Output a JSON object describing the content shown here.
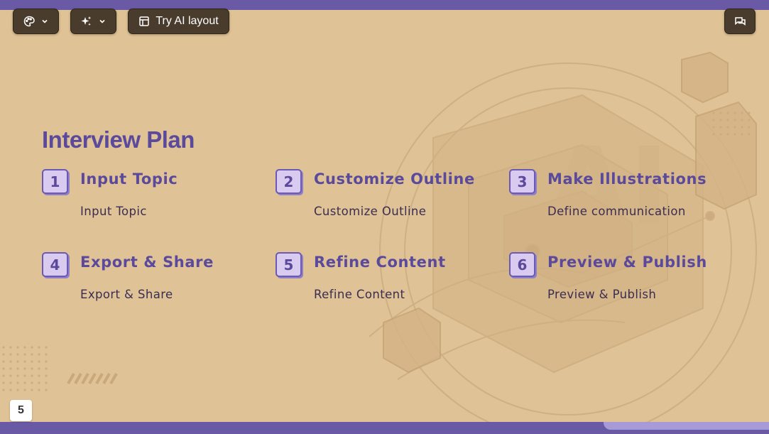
{
  "toolbar": {
    "theme_icon": "palette-icon",
    "ai_icon": "sparkles-icon",
    "layout_label": "Try AI layout",
    "layout_icon": "layout-icon",
    "comment_icon": "comment-icon"
  },
  "slide": {
    "title": "Interview Plan",
    "steps": [
      {
        "num": "1",
        "title": "Input Topic",
        "desc": "Input Topic"
      },
      {
        "num": "2",
        "title": "Customize Outline",
        "desc": "Customize Outline"
      },
      {
        "num": "3",
        "title": "Make Illustrations",
        "desc": "Define communication"
      },
      {
        "num": "4",
        "title": "Export & Share",
        "desc": "Export & Share"
      },
      {
        "num": "5",
        "title": "Refine Content",
        "desc": "Refine Content"
      },
      {
        "num": "6",
        "title": "Preview & Publish",
        "desc": "Preview & Publish"
      }
    ]
  },
  "page_number": "5",
  "colors": {
    "frame": "#6a5aa6",
    "slide_bg": "#dfc295",
    "accent_text": "#5b4a9c",
    "body_text": "#3b2d52",
    "toolbar_button": "#4a3c2c"
  }
}
